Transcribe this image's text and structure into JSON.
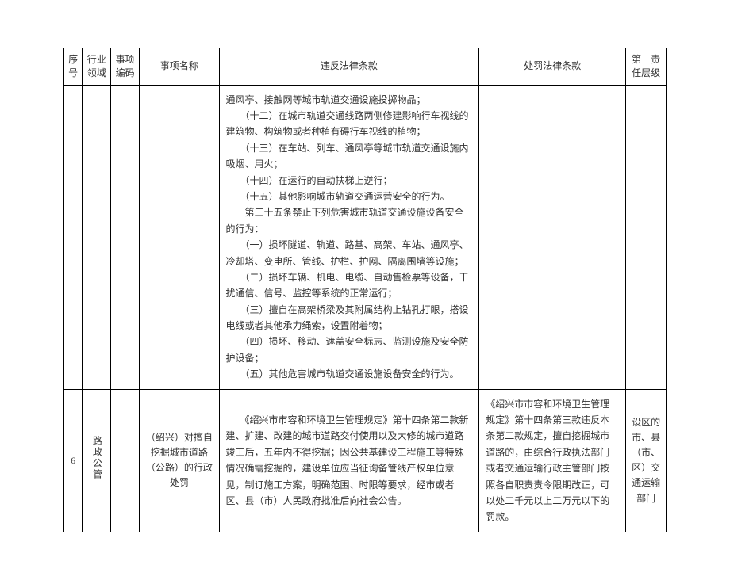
{
  "headers": {
    "seq": "序号",
    "domain": "行业领域",
    "code": "事项编码",
    "name": "事项名称",
    "violation": "违反法律条款",
    "penalty": "处罚法律条款",
    "responsibility": "第一责任层级"
  },
  "rows": [
    {
      "seq": "",
      "domain": "",
      "code": "",
      "name": "",
      "violation_lines": [
        "通风亭、接触网等城市轨道交通设施投掷物品；",
        "　　（十二）在城市轨道交通线路两侧修建影响行车视线的建筑物、构筑物或者种植有碍行车视线的植物；",
        "　　（十三）在车站、列车、通风亭等城市轨道交通设施内吸烟、用火；",
        "　　（十四）在运行的自动扶梯上逆行；",
        "　　（十五）其他影响城市轨道交通运营安全的行为。",
        "　　第三十五条禁止下列危害城市轨道交通设施设备安全的行为：",
        "　　（一）损坏隧道、轨道、路基、高架、车站、通风亭、冷却塔、变电所、管线、护栏、护网、隔离围墙等设施；",
        "　　（二）损坏车辆、机电、电缆、自动售检票等设备，干扰通信、信号、监控等系统的正常运行；",
        "　　（三）擅自在高架桥梁及其附属结构上钻孔打眼，搭设电线或者其他承力绳索，设置附着物；",
        "　　（四）损坏、移动、遮盖安全标志、监测设施及安全防护设备；",
        "　　（五）其他危害城市轨道交通设施设备安全的行为。"
      ],
      "penalty": "",
      "responsibility": ""
    },
    {
      "seq": "6",
      "domain": "路政公管",
      "code": "",
      "name": "（绍兴）对擅自挖掘城市道路（公路）的行政处罚",
      "violation": "　　《绍兴市市容和环境卫生管理规定》第十四条第二款新建、扩建、改建的城市道路交付使用以及大修的城市道路竣工后，五年内不得挖掘；因公共基建设工程施工等特殊情况确需挖掘的，建设单位应当征询备管线产权单位意见，制订施工方案，明确范围、时限等要求，经市或者区、县（市）人民政府批准后向社会公告。",
      "penalty": "《绍兴市市容和环境卫生管理规定》第十四条第三款违反本条第二款规定，擅自挖掘城市道路的，由综合行政执法部门或者交通运输行政主管部门按照各自职责责令限期改正，可以处二千元以上二万元以下的罚款。",
      "responsibility": "设区的市、县（市、区）交通运输部门"
    }
  ]
}
